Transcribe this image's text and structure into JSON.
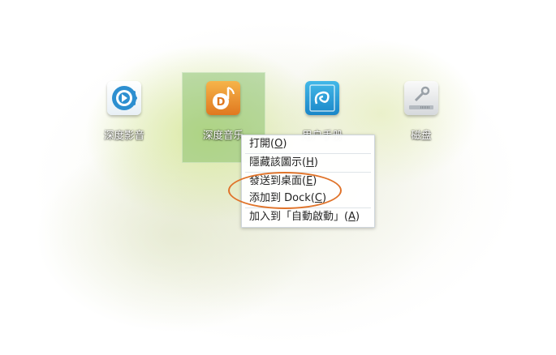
{
  "apps": [
    {
      "id": "deepin-movie",
      "label": "深度影音",
      "icon": "movie-player-icon"
    },
    {
      "id": "deepin-music",
      "label": "深度音乐",
      "icon": "music-player-icon"
    },
    {
      "id": "user-manual",
      "label": "用户手册",
      "icon": "user-manual-icon"
    },
    {
      "id": "disk",
      "label": "磁盘",
      "icon": "disk-icon"
    }
  ],
  "context_menu": {
    "items": [
      {
        "text": "打開(",
        "mnemonic": "O",
        "close": ")"
      },
      {
        "text": "隱藏該圖示(",
        "mnemonic": "H",
        "close": ")"
      },
      {
        "text": "發送到桌面(",
        "mnemonic": "E",
        "close": ")"
      },
      {
        "text": "添加到 Dock(",
        "mnemonic": "C",
        "close": ")"
      },
      {
        "text": "加入到「自動啟動」(",
        "mnemonic": "A",
        "close": ")"
      }
    ]
  },
  "highlight_color": "#e0732a"
}
